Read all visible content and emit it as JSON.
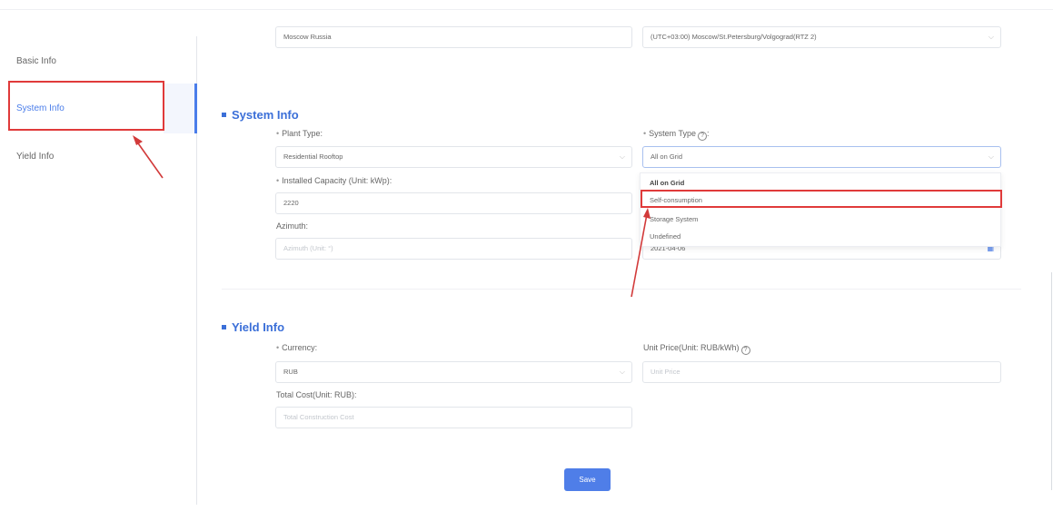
{
  "sidebar": {
    "items": [
      {
        "label": "Basic Info"
      },
      {
        "label": "System Info"
      },
      {
        "label": "Yield Info"
      }
    ]
  },
  "basic": {
    "name_value": "Moscow Russia",
    "timezone_value": "(UTC+03:00) Moscow/St.Petersburg/Volgograd(RTZ 2)"
  },
  "system": {
    "title": "System Info",
    "plant_type_label": "Plant Type:",
    "plant_type_value": "Residential Rooftop",
    "system_type_label": "System Type",
    "system_type_value": "All on Grid",
    "capacity_label": "Installed Capacity (Unit: kWp):",
    "capacity_value": "2220",
    "azimuth_label": "Azimuth:",
    "azimuth_placeholder": "Azimuth (Unit: °)",
    "date_partial": "2021-04-06",
    "dropdown_options": [
      "All on Grid",
      "Self-consumption",
      "Storage System",
      "Undefined"
    ]
  },
  "yield": {
    "title": "Yield Info",
    "currency_label": "Currency:",
    "currency_value": "RUB",
    "unit_price_label": "Unit Price(Unit: RUB/kWh)",
    "unit_price_placeholder": "Unit Price",
    "total_cost_label": "Total Cost(Unit: RUB):",
    "total_cost_placeholder": "Total Construction Cost"
  },
  "actions": {
    "save_label": "Save"
  },
  "colors": {
    "accent": "#4a7dea",
    "highlight": "#e03a3a"
  },
  "icons": {
    "help": "question-circle-icon",
    "select": "chevron-down-icon",
    "calendar": "calendar-icon"
  }
}
